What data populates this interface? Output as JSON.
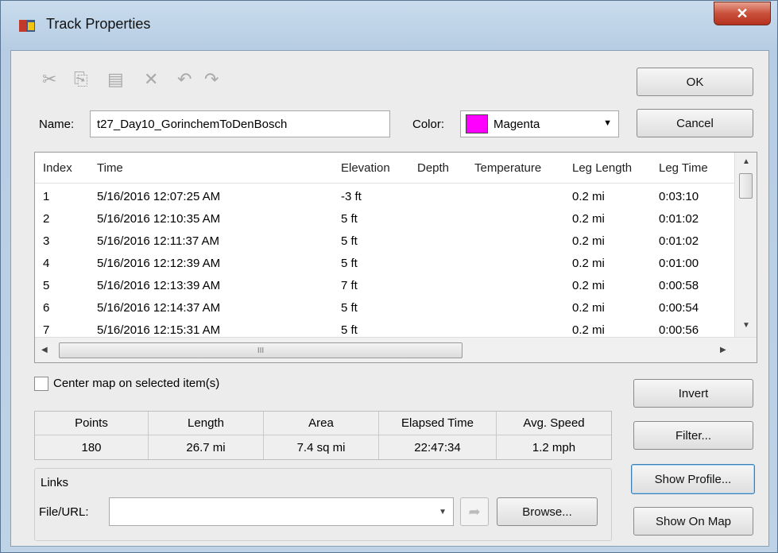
{
  "window": {
    "title": "Track Properties"
  },
  "toolbar": {
    "cut": "✂",
    "copy": "⎘",
    "paste": "▤",
    "delete": "✕",
    "undo": "↶",
    "redo": "↷"
  },
  "buttons": {
    "ok": "OK",
    "cancel": "Cancel",
    "invert": "Invert",
    "filter": "Filter...",
    "show_profile": "Show Profile...",
    "show_on_map": "Show On Map",
    "browse": "Browse..."
  },
  "name_field": {
    "label": "Name:",
    "value": "t27_Day10_GorinchemToDenBosch"
  },
  "color_field": {
    "label": "Color:",
    "value": "Magenta",
    "swatch": "#ff00ff"
  },
  "table": {
    "columns": [
      "Index",
      "Time",
      "Elevation",
      "Depth",
      "Temperature",
      "Leg Length",
      "Leg Time"
    ],
    "rows": [
      [
        "1",
        "5/16/2016 12:07:25 AM",
        "-3 ft",
        "",
        "",
        "0.2 mi",
        "0:03:10"
      ],
      [
        "2",
        "5/16/2016 12:10:35 AM",
        "5 ft",
        "",
        "",
        "0.2 mi",
        "0:01:02"
      ],
      [
        "3",
        "5/16/2016 12:11:37 AM",
        "5 ft",
        "",
        "",
        "0.2 mi",
        "0:01:02"
      ],
      [
        "4",
        "5/16/2016 12:12:39 AM",
        "5 ft",
        "",
        "",
        "0.2 mi",
        "0:01:00"
      ],
      [
        "5",
        "5/16/2016 12:13:39 AM",
        "7 ft",
        "",
        "",
        "0.2 mi",
        "0:00:58"
      ],
      [
        "6",
        "5/16/2016 12:14:37 AM",
        "5 ft",
        "",
        "",
        "0.2 mi",
        "0:00:54"
      ],
      [
        "7",
        "5/16/2016 12:15:31 AM",
        "5 ft",
        "",
        "",
        "0.2 mi",
        "0:00:56"
      ]
    ],
    "hscroll_grip": "III"
  },
  "center_map": {
    "label": "Center map on selected item(s)",
    "checked": false
  },
  "stats": [
    {
      "label": "Points",
      "value": "180"
    },
    {
      "label": "Length",
      "value": "26.7 mi"
    },
    {
      "label": "Area",
      "value": "7.4 sq mi"
    },
    {
      "label": "Elapsed Time",
      "value": "22:47:34"
    },
    {
      "label": "Avg. Speed",
      "value": "1.2 mph"
    }
  ],
  "links": {
    "group_label": "Links",
    "file_label": "File/URL:",
    "file_value": ""
  }
}
